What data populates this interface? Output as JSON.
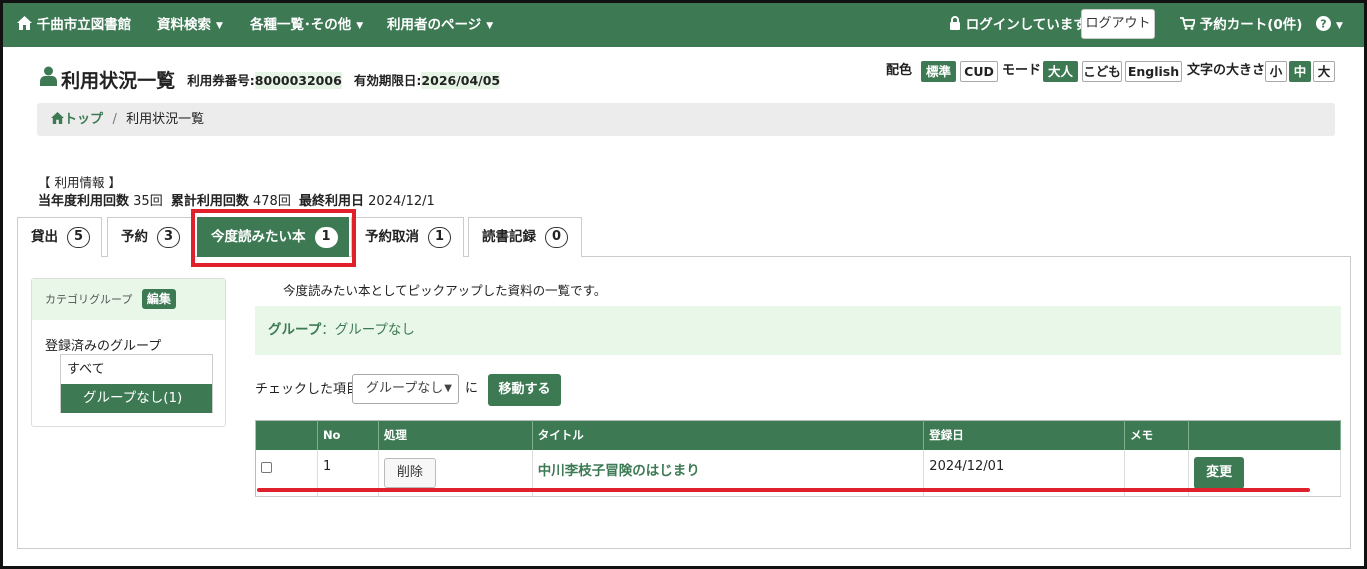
{
  "navbar": {
    "site_title": "千曲市立図書館",
    "menu": [
      "資料検索",
      "各種一覧･その他",
      "利用者のページ"
    ],
    "login_status": "ログインしています",
    "logout_label": "ログアウト",
    "cart_label": "予約カート(0件)",
    "help_icon": "question-circle-icon"
  },
  "header": {
    "page_title": "利用状況一覧",
    "card_label": "利用券番号:",
    "card_number": "8000032006",
    "expiry_label": "有効期限日:",
    "expiry_date": "2026/04/05"
  },
  "prefs": {
    "color_label": "配色",
    "color_options": [
      "標準",
      "CUD"
    ],
    "mode_label": "モード",
    "mode_options": [
      "大人",
      "こども",
      "English"
    ],
    "size_label": "文字の大きさ",
    "size_options": [
      "小",
      "中",
      "大"
    ]
  },
  "breadcrumb": {
    "home": "トップ",
    "separator": "/",
    "current": "利用状況一覧"
  },
  "usage_info": {
    "heading": "【 利用情報 】",
    "year_count_label": "当年度利用回数",
    "year_count": "35回",
    "total_label": "累計利用回数",
    "total": "478回",
    "last_label": "最終利用日",
    "last_date": "2024/12/1"
  },
  "tabs": [
    {
      "label": "貸出",
      "count": "5"
    },
    {
      "label": "予約",
      "count": "3"
    },
    {
      "label": "今度読みたい本",
      "count": "1"
    },
    {
      "label": "予約取消",
      "count": "1"
    },
    {
      "label": "読書記録",
      "count": "0"
    }
  ],
  "sidebar": {
    "category_label": "カテゴリグループ",
    "edit_label": "編集",
    "registered_label": "登録済みのグループ",
    "groups": [
      "すべて",
      "グループなし(1)"
    ]
  },
  "main": {
    "description": "今度読みたい本としてピックアップした資料の一覧です。",
    "group_label": "グループ",
    "group_value": "：グループなし",
    "move_prefix": "チェックした項目を",
    "select_value": "グループなし",
    "move_suffix": "に",
    "move_button": "移動する"
  },
  "table": {
    "headers": [
      "",
      "No",
      "処理",
      "タイトル",
      "登録日",
      "メモ",
      ""
    ],
    "rows": [
      {
        "no": "1",
        "action": "削除",
        "title": "中川李枝子冒険のはじまり",
        "date": "2024/12/01",
        "memo": "",
        "change": "変更"
      }
    ]
  },
  "colors": {
    "brand_green": "#3d7a54",
    "highlight_red": "#e0202a",
    "light_green_bg": "#e9f7e9"
  }
}
